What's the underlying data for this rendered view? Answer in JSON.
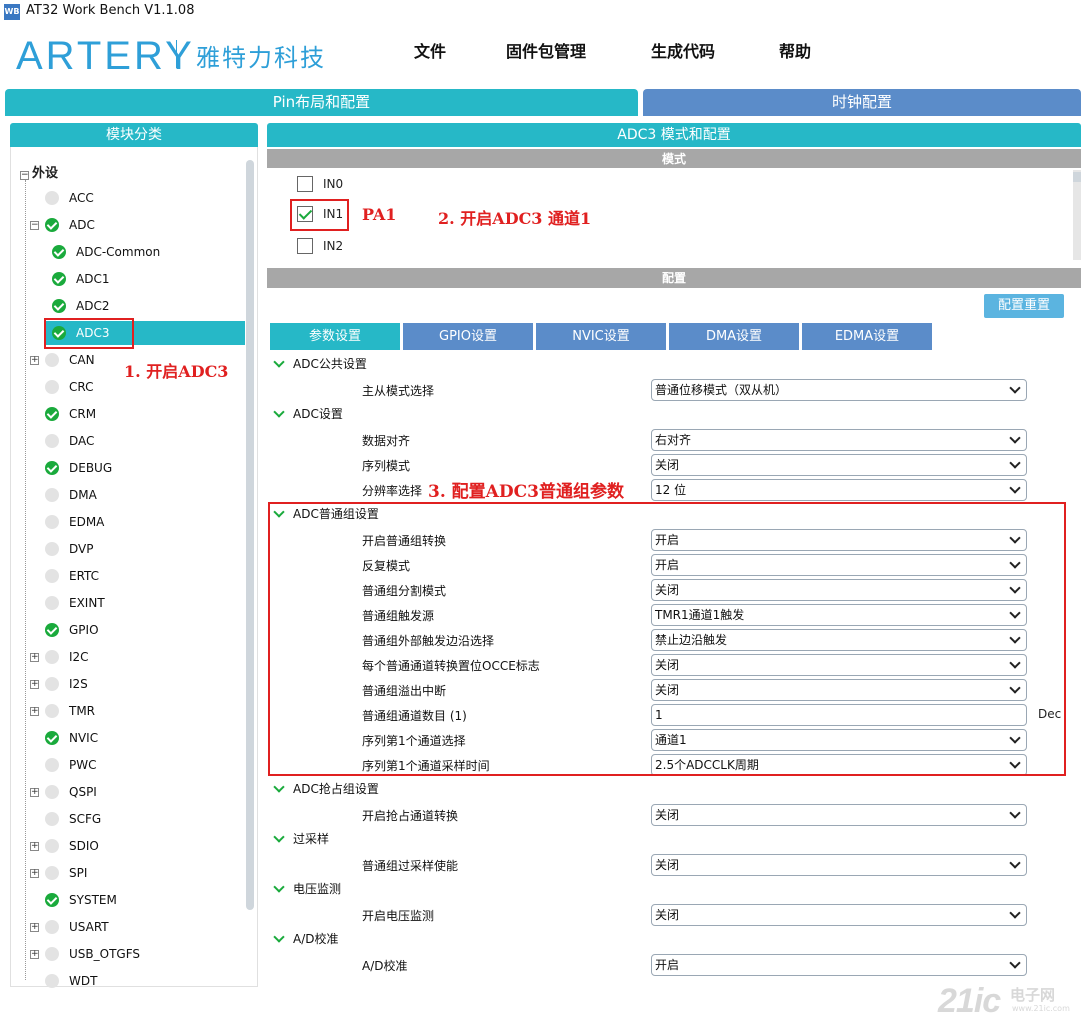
{
  "window": {
    "title": "AT32 Work Bench V1.1.08",
    "icon": "WB"
  },
  "header": {
    "logo_text": "ARTERY",
    "logo_cn": "雅特力科技",
    "menu": [
      "文件",
      "固件包管理",
      "生成代码",
      "帮助"
    ]
  },
  "tabs": {
    "pin": "Pin布局和配置",
    "clock": "时钟配置"
  },
  "left": {
    "title": "模块分类",
    "root": "外设",
    "items": [
      {
        "label": "ACC",
        "status": "off",
        "expandable": false,
        "level": 1
      },
      {
        "label": "ADC",
        "status": "ok",
        "expandable": true,
        "expanded": true,
        "level": 1
      },
      {
        "label": "ADC-Common",
        "status": "ok",
        "level": 2
      },
      {
        "label": "ADC1",
        "status": "ok",
        "level": 2
      },
      {
        "label": "ADC2",
        "status": "ok",
        "level": 2
      },
      {
        "label": "ADC3",
        "status": "ok",
        "level": 2,
        "selected": true
      },
      {
        "label": "CAN",
        "status": "off",
        "expandable": true,
        "level": 1
      },
      {
        "label": "CRC",
        "status": "off",
        "level": 1
      },
      {
        "label": "CRM",
        "status": "ok",
        "level": 1
      },
      {
        "label": "DAC",
        "status": "off",
        "level": 1
      },
      {
        "label": "DEBUG",
        "status": "ok",
        "level": 1
      },
      {
        "label": "DMA",
        "status": "off",
        "level": 1
      },
      {
        "label": "EDMA",
        "status": "off",
        "level": 1
      },
      {
        "label": "DVP",
        "status": "off",
        "level": 1
      },
      {
        "label": "ERTC",
        "status": "off",
        "level": 1
      },
      {
        "label": "EXINT",
        "status": "off",
        "level": 1
      },
      {
        "label": "GPIO",
        "status": "ok",
        "level": 1
      },
      {
        "label": "I2C",
        "status": "off",
        "expandable": true,
        "level": 1
      },
      {
        "label": "I2S",
        "status": "off",
        "expandable": true,
        "level": 1
      },
      {
        "label": "TMR",
        "status": "off",
        "expandable": true,
        "level": 1
      },
      {
        "label": "NVIC",
        "status": "ok",
        "level": 1
      },
      {
        "label": "PWC",
        "status": "off",
        "level": 1
      },
      {
        "label": "QSPI",
        "status": "off",
        "expandable": true,
        "level": 1
      },
      {
        "label": "SCFG",
        "status": "off",
        "level": 1
      },
      {
        "label": "SDIO",
        "status": "off",
        "expandable": true,
        "level": 1
      },
      {
        "label": "SPI",
        "status": "off",
        "expandable": true,
        "level": 1
      },
      {
        "label": "SYSTEM",
        "status": "ok",
        "level": 1
      },
      {
        "label": "USART",
        "status": "off",
        "expandable": true,
        "level": 1
      },
      {
        "label": "USB_OTGFS",
        "status": "off",
        "expandable": true,
        "level": 1
      },
      {
        "label": "WDT",
        "status": "off",
        "level": 1
      }
    ]
  },
  "right": {
    "title": "ADC3 模式和配置",
    "mode_bar": "模式",
    "config_bar": "配置",
    "channels": [
      {
        "label": "IN0",
        "checked": false
      },
      {
        "label": "IN1",
        "checked": true
      },
      {
        "label": "IN2",
        "checked": false
      }
    ],
    "reset_button": "配置重置",
    "subtabs": [
      "参数设置",
      "GPIO设置",
      "NVIC设置",
      "DMA设置",
      "EDMA设置"
    ],
    "dec_unit": "Dec",
    "sections": [
      {
        "title": "ADC公共设置",
        "params": [
          {
            "label": "主从模式选择",
            "value": "普通位移模式（双从机）"
          }
        ]
      },
      {
        "title": "ADC设置",
        "params": [
          {
            "label": "数据对齐",
            "value": "右对齐"
          },
          {
            "label": "序列模式",
            "value": "关闭"
          },
          {
            "label": "分辨率选择",
            "value": "12 位"
          }
        ]
      },
      {
        "title": "ADC普通组设置",
        "params": [
          {
            "label": "开启普通组转换",
            "value": "开启"
          },
          {
            "label": "反复模式",
            "value": "开启"
          },
          {
            "label": "普通组分割模式",
            "value": "关闭"
          },
          {
            "label": "普通组触发源",
            "value": "TMR1通道1触发"
          },
          {
            "label": "普通组外部触发边沿选择",
            "value": "禁止边沿触发"
          },
          {
            "label": "每个普通通道转换置位OCCE标志",
            "value": "关闭"
          },
          {
            "label": "普通组溢出中断",
            "value": "关闭"
          },
          {
            "label": "普通组通道数目 (1)",
            "value": "1",
            "input": true
          },
          {
            "label": "序列第1个通道选择",
            "value": "通道1"
          },
          {
            "label": "序列第1个通道采样时间",
            "value": "2.5个ADCCLK周期"
          }
        ]
      },
      {
        "title": "ADC抢占组设置",
        "params": [
          {
            "label": "开启抢占通道转换",
            "value": "关闭"
          }
        ]
      },
      {
        "title": "过采样",
        "params": [
          {
            "label": "普通组过采样使能",
            "value": "关闭"
          }
        ]
      },
      {
        "title": "电压监测",
        "params": [
          {
            "label": "开启电压监测",
            "value": "关闭"
          }
        ]
      },
      {
        "title": "A/D校准",
        "params": [
          {
            "label": "A/D校准",
            "value": "开启"
          }
        ]
      }
    ]
  },
  "annotations": {
    "pa1": "PA1",
    "step2": "2. 开启ADC3  通道1",
    "step1": "1. 开启ADC3",
    "step3": "3. 配置ADC3普通组参数",
    "color": "#e02020"
  },
  "watermark": {
    "logo": "21ic",
    "cn": "电子网",
    "url": "www.21ic.com"
  }
}
